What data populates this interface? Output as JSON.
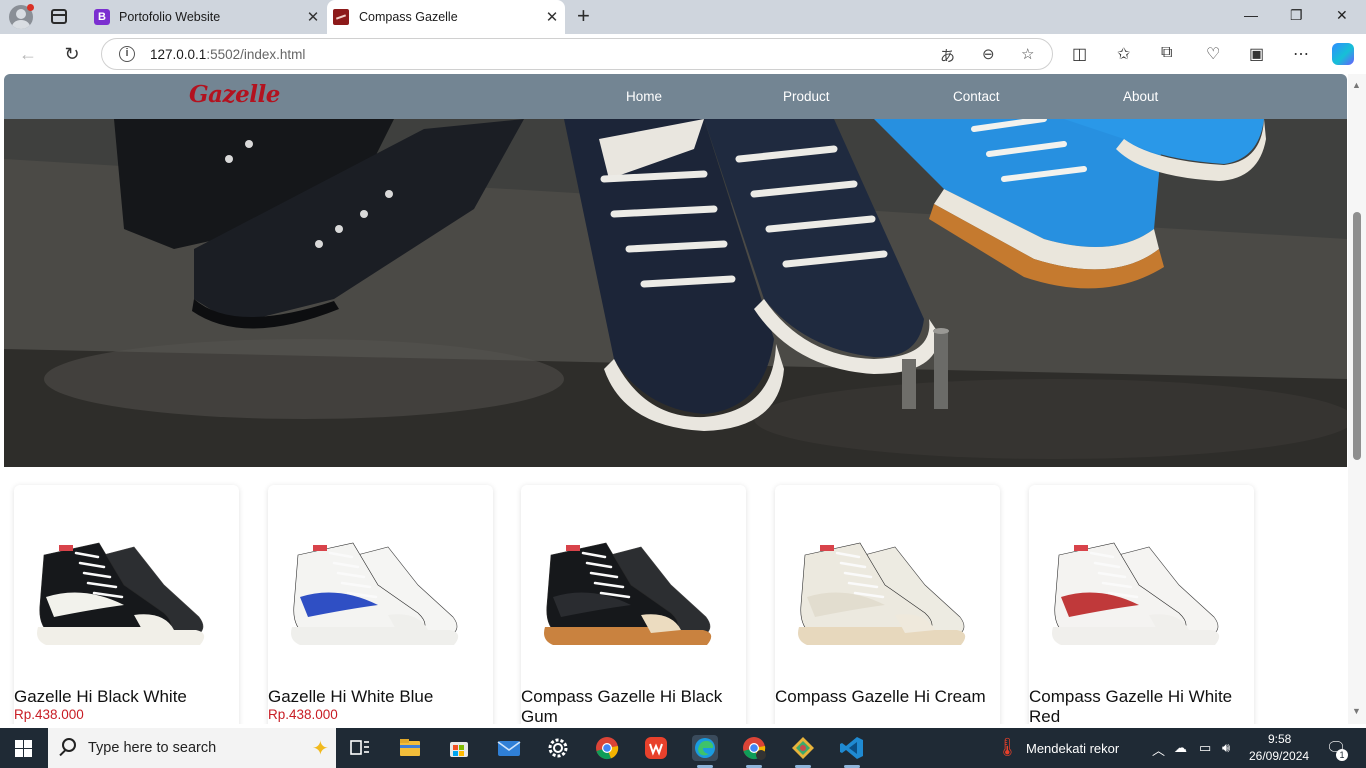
{
  "browser": {
    "tabs": [
      {
        "title": "Portofolio Website",
        "favicon": "B"
      },
      {
        "title": "Compass Gazelle",
        "favicon": "compass-logo"
      }
    ],
    "url_host": "127.0.0.1",
    "url_rest": ":5502/index.html",
    "window_controls": {
      "minimize": "—",
      "restore": "❐",
      "close": "✕"
    }
  },
  "site": {
    "brand": "Gazelle",
    "nav": [
      "Home",
      "Product",
      "Contact",
      "About"
    ]
  },
  "products": [
    {
      "name": "Gazelle Hi Black White",
      "price": "Rp.438.000",
      "upper": "#16181b",
      "swoosh": "#f2f2ec",
      "sole": "#f1efe8",
      "toe": "#f1efe8"
    },
    {
      "name": "Gazelle Hi White Blue",
      "price": "Rp.438.000",
      "upper": "#f4f4f2",
      "swoosh": "#2f4fc4",
      "sole": "#efefec",
      "toe": "#efefec"
    },
    {
      "name": "Compass Gazelle Hi Black Gum",
      "price": "",
      "upper": "#16181b",
      "swoosh": "#2a2c30",
      "sole": "#c9823f",
      "toe": "#ecdcc0"
    },
    {
      "name": "Compass Gazelle Hi Cream",
      "price": "",
      "upper": "#ece9df",
      "swoosh": "#e2ddcf",
      "sole": "#e7d8bd",
      "toe": "#efe9dc"
    },
    {
      "name": "Compass Gazelle Hi White Red",
      "price": "",
      "upper": "#f4f3f1",
      "swoosh": "#c0393a",
      "sole": "#f0efec",
      "toe": "#f0efec"
    }
  ],
  "taskbar": {
    "search_placeholder": "Type here to search",
    "weather": "Mendekati rekor",
    "time": "9:58",
    "date": "26/09/2024",
    "notifications": "1"
  }
}
